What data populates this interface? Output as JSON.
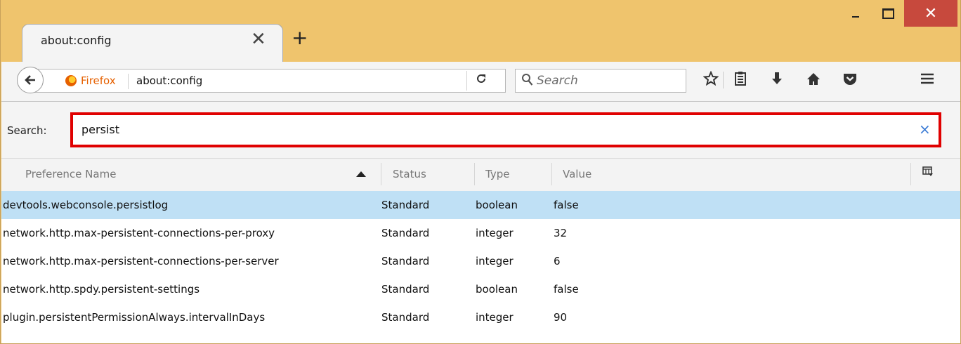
{
  "window": {
    "close_glyph": "✕"
  },
  "tabs": [
    {
      "title": "about:config",
      "close_glyph": "✕"
    }
  ],
  "new_tab_glyph": "+",
  "navbar": {
    "identity_label": "Firefox",
    "url": "about:config",
    "search_placeholder": "Search",
    "icons": [
      "back-arrow-icon",
      "firefox-icon",
      "reload-icon",
      "search-icon",
      "bookmark-star-icon",
      "reading-list-icon",
      "download-icon",
      "home-icon",
      "pocket-icon",
      "menu-icon"
    ]
  },
  "config_search": {
    "label": "Search:",
    "value": "persist",
    "clear_glyph": "×",
    "highlight_color": "#e00000"
  },
  "table": {
    "columns": [
      "Preference Name",
      "Status",
      "Type",
      "Value"
    ],
    "sorted_by": "Preference Name",
    "rows": [
      {
        "name": "devtools.webconsole.persistlog",
        "status": "Standard",
        "type": "boolean",
        "value": "false",
        "selected": true
      },
      {
        "name": "network.http.max-persistent-connections-per-proxy",
        "status": "Standard",
        "type": "integer",
        "value": "32"
      },
      {
        "name": "network.http.max-persistent-connections-per-server",
        "status": "Standard",
        "type": "integer",
        "value": "6"
      },
      {
        "name": "network.http.spdy.persistent-settings",
        "status": "Standard",
        "type": "boolean",
        "value": "false"
      },
      {
        "name": "plugin.persistentPermissionAlways.intervalInDays",
        "status": "Standard",
        "type": "integer",
        "value": "90"
      }
    ]
  },
  "colors": {
    "titlebar": "#efc46d",
    "selection": "#bfe0f5",
    "close_button": "#c7493d",
    "firefox_orange": "#e66000"
  }
}
